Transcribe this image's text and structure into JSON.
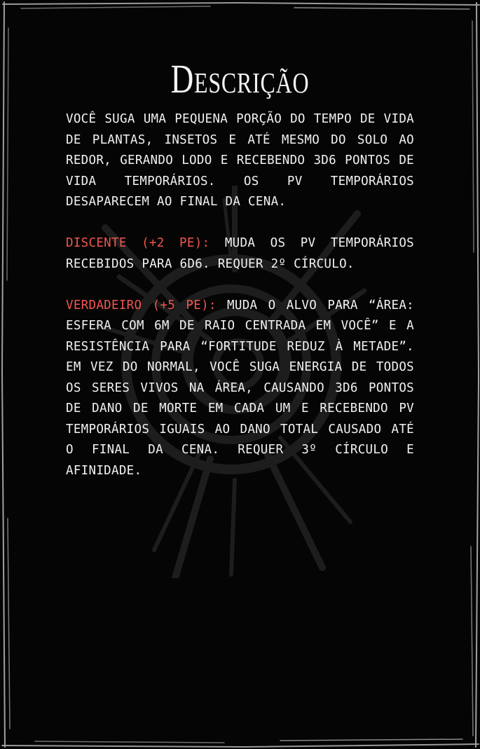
{
  "title": "Descrição",
  "paragraphs": {
    "main": "Você suga uma pequena porção do tempo de vida de plantas, insetos e até mesmo do solo ao redor, gerando lodo e recebendo 3d6 pontos de vida temporários. Os PV temporários desaparecem ao final da cena.",
    "discente": {
      "label": "Discente (+2 PE):",
      "text": " Muda os PV temporários recebidos para 6d6. Requer 2º círculo."
    },
    "verdadeiro": {
      "label": "Verdadeiro (+5 PE):",
      "text": " Muda o alvo para “área: esfera com 6m de raio centrada em você” e a resistência para “Fortitude reduz à metade”. Em vez do normal, você suga energia de todos os seres vivos na área, causando 3d6 pontos de dano de Morte em cada um e recebendo PV temporários iguais ao dano total causado até o final da cena. Requer 3º círculo e afinidade."
    }
  },
  "colors": {
    "background": "#050505",
    "text": "#f2f2f2",
    "accent": "#f0564f"
  },
  "icons": {
    "background": "sigil-watermark",
    "frame": "scratched-border"
  }
}
